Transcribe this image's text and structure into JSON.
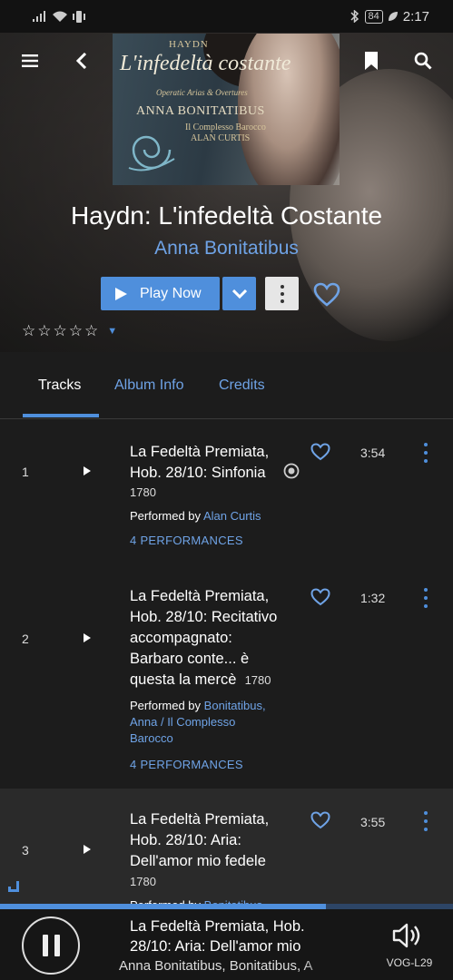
{
  "status_bar": {
    "battery": "84",
    "time": "2:17"
  },
  "album": {
    "title": "Haydn: L'infedeltà Costante",
    "artist": "Anna Bonitatibus",
    "cover": {
      "composer": "HAYDN",
      "title": "L'infedeltà costante",
      "subtitle": "Operatic Arias & Overtures",
      "artist": "ANNA BONITATIBUS",
      "ensemble": "Il Complesso Barocco",
      "conductor": "ALAN CURTIS"
    }
  },
  "actions": {
    "play_label": "Play Now"
  },
  "rating": {
    "stars": 0,
    "max": 5
  },
  "tabs": [
    {
      "label": "Tracks",
      "active": true
    },
    {
      "label": "Album Info",
      "active": false
    },
    {
      "label": "Credits",
      "active": false
    }
  ],
  "tracks": [
    {
      "number": "1",
      "title_lines": [
        "La Fedeltà Premiata,",
        "Hob. 28/10: Sinfonia"
      ],
      "year": "1780",
      "performed_by_label": "Performed by",
      "performers": "Alan Curtis",
      "performances": "4 PERFORMANCES",
      "duration": "3:54"
    },
    {
      "number": "2",
      "title_lines": [
        "La Fedeltà Premiata,",
        "Hob. 28/10: Recitativo",
        "accompagnato:",
        "Barbaro conte... è",
        "questa la mercè"
      ],
      "year": "1780",
      "performed_by_label": "Performed by",
      "performers_lines": [
        "Bonitatibus,",
        "Anna / Il Complesso",
        "Barocco"
      ],
      "performances": "4 PERFORMANCES",
      "duration": "1:32"
    },
    {
      "number": "3",
      "title_lines": [
        "La Fedeltà Premiata,",
        "Hob. 28/10: Aria:",
        "Dell'amor mio fedele"
      ],
      "year": "1780",
      "performed_by_label": "Performed by",
      "performers": "Bonitatibus,",
      "duration": "3:55"
    }
  ],
  "now_playing": {
    "title_lines": [
      "La Fedeltà Premiata, Hob.",
      "28/10: Aria: Dell'amor mio"
    ],
    "artist": "Anna Bonitatibus, Bonitatibus, A",
    "device": "VOG-L29",
    "progress": 0.72
  },
  "colors": {
    "accent": "#4f8fdc",
    "link": "#6fa3e6",
    "background": "#1c1c1c"
  }
}
